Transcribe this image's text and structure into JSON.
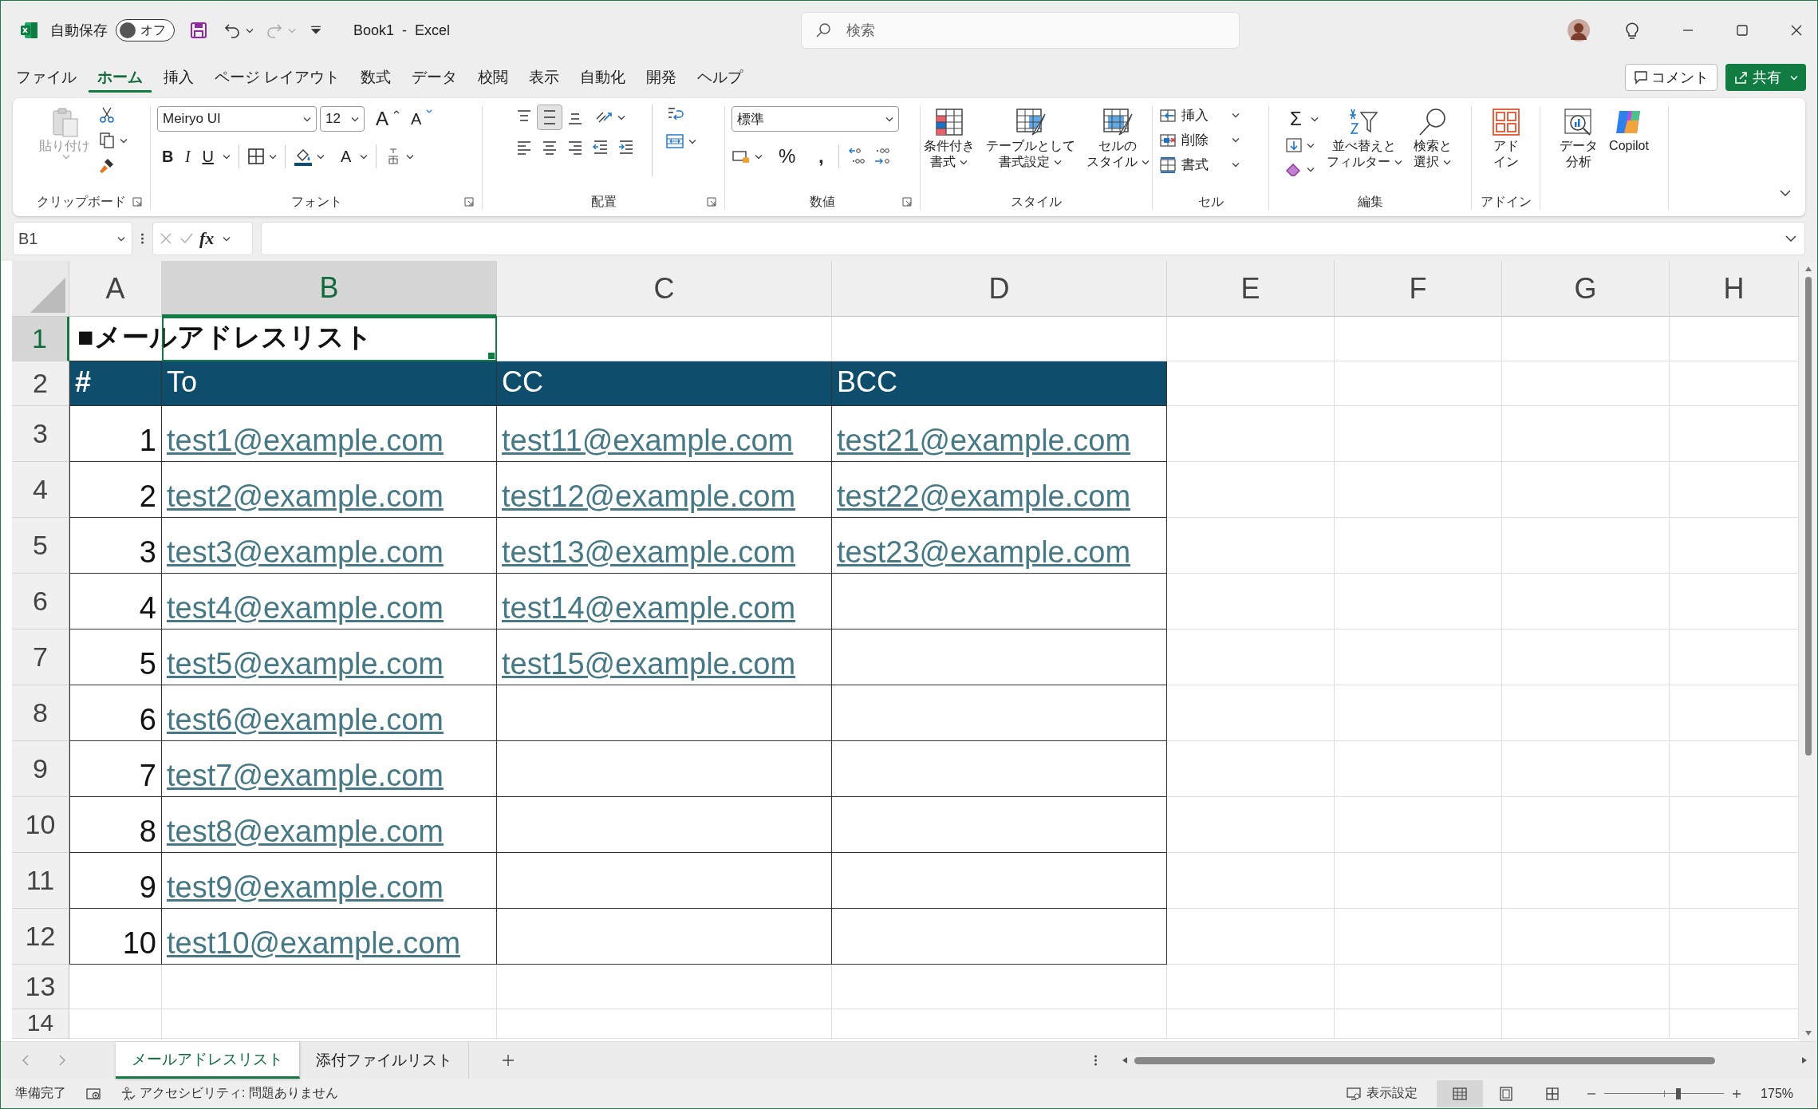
{
  "title_bar": {
    "autosave_label": "自動保存",
    "autosave_toggle": {
      "label": "オフ",
      "on": false
    },
    "document_title": "Book1  -  Excel",
    "search": {
      "placeholder": "検索"
    }
  },
  "menu_tabs": [
    {
      "label": "ファイル",
      "selected": false
    },
    {
      "label": "ホーム",
      "selected": true
    },
    {
      "label": "挿入",
      "selected": false
    },
    {
      "label": "ページ レイアウト",
      "selected": false
    },
    {
      "label": "数式",
      "selected": false
    },
    {
      "label": "データ",
      "selected": false
    },
    {
      "label": "校閲",
      "selected": false
    },
    {
      "label": "表示",
      "selected": false
    },
    {
      "label": "自動化",
      "selected": false
    },
    {
      "label": "開発",
      "selected": false
    },
    {
      "label": "ヘルプ",
      "selected": false
    }
  ],
  "comment_button": {
    "label": "コメント"
  },
  "share_button": {
    "label": "共有"
  },
  "ribbon": {
    "clipboard": {
      "paste": {
        "label": "貼り付け",
        "disabled": true
      },
      "group_label": "クリップボード"
    },
    "font": {
      "font_name": "Meiryo UI",
      "font_size": "12",
      "grow": "A",
      "shrink": "A",
      "bold": "B",
      "italic": "I",
      "underline": "U",
      "font_color": "A",
      "group_label": "フォント"
    },
    "alignment": {
      "vertical": [
        {
          "selected": false
        },
        {
          "selected": true
        },
        {
          "selected": false
        }
      ],
      "group_label": "配置"
    },
    "number": {
      "format": "標準",
      "percent": "%",
      "comma": ",",
      "group_label": "数値"
    },
    "styles": {
      "buttons": [
        {
          "lines": [
            "条件付き",
            "書式"
          ]
        },
        {
          "lines": [
            "テーブルとして",
            "書式設定"
          ]
        },
        {
          "lines": [
            "セルの",
            "スタイル"
          ]
        }
      ],
      "group_label": "スタイル"
    },
    "cells": {
      "buttons": [
        "挿入",
        "削除",
        "書式"
      ],
      "group_label": "セル"
    },
    "editing": {
      "autosum": "Σ",
      "buttons": [
        {
          "lines": [
            "並べ替えと",
            "フィルター"
          ]
        },
        {
          "lines": [
            "検索と",
            "選択"
          ]
        }
      ],
      "group_label": "編集"
    },
    "add_ins": {
      "buttons": [
        {
          "lines": [
            "アド",
            "イン"
          ]
        }
      ],
      "group_label": "アドイン"
    },
    "analysis": {
      "buttons": [
        {
          "lines": [
            "データ",
            "分析"
          ]
        },
        {
          "lines": [
            "Copilot"
          ]
        }
      ]
    }
  },
  "formula_bar": {
    "name_box": "B1",
    "function_label": "fx"
  },
  "sheet": {
    "columns": [
      {
        "label": "A",
        "selected": false
      },
      {
        "label": "B",
        "selected": true
      },
      {
        "label": "C",
        "selected": false
      },
      {
        "label": "D",
        "selected": false
      },
      {
        "label": "E",
        "selected": false
      },
      {
        "label": "F",
        "selected": false
      },
      {
        "label": "G",
        "selected": false
      },
      {
        "label": "H",
        "selected": false
      }
    ],
    "rows": [
      {
        "label": "1",
        "selected": true
      },
      {
        "label": "2",
        "selected": false
      },
      {
        "label": "3",
        "selected": false
      },
      {
        "label": "4",
        "selected": false
      },
      {
        "label": "5",
        "selected": false
      },
      {
        "label": "6",
        "selected": false
      },
      {
        "label": "7",
        "selected": false
      },
      {
        "label": "8",
        "selected": false
      },
      {
        "label": "9",
        "selected": false
      },
      {
        "label": "10",
        "selected": false
      },
      {
        "label": "11",
        "selected": false
      },
      {
        "label": "12",
        "selected": false
      },
      {
        "label": "13",
        "selected": false
      },
      {
        "label": "14",
        "selected": false
      }
    ],
    "title": "■メールアドレスリスト",
    "table": {
      "headers": [
        "#",
        "To",
        "CC",
        "BCC"
      ],
      "rows": [
        {
          "number": "1",
          "to": "test1@example.com",
          "cc": "test11@example.com",
          "bcc": "test21@example.com"
        },
        {
          "number": "2",
          "to": "test2@example.com",
          "cc": "test12@example.com",
          "bcc": "test22@example.com"
        },
        {
          "number": "3",
          "to": "test3@example.com",
          "cc": "test13@example.com",
          "bcc": "test23@example.com"
        },
        {
          "number": "4",
          "to": "test4@example.com",
          "cc": "test14@example.com"
        },
        {
          "number": "5",
          "to": "test5@example.com",
          "cc": "test15@example.com"
        },
        {
          "number": "6",
          "to": "test6@example.com"
        },
        {
          "number": "7",
          "to": "test7@example.com"
        },
        {
          "number": "8",
          "to": "test8@example.com"
        },
        {
          "number": "9",
          "to": "test9@example.com"
        },
        {
          "number": "10",
          "to": "test10@example.com"
        }
      ]
    }
  },
  "sheet_tabs": [
    {
      "label": "メールアドレスリスト",
      "selected": true
    },
    {
      "label": "添付ファイルリスト",
      "selected": false
    }
  ],
  "status_bar": {
    "ready": "準備完了",
    "accessibility": "アクセシビリティ: 問題ありません",
    "display_settings": "表示設定",
    "views": [
      {
        "kind": "normal",
        "selected": true
      },
      {
        "kind": "page_layout",
        "selected": false
      },
      {
        "kind": "page_break",
        "selected": false
      }
    ],
    "zoom": {
      "level": 0.62,
      "reading": "175%"
    }
  }
}
